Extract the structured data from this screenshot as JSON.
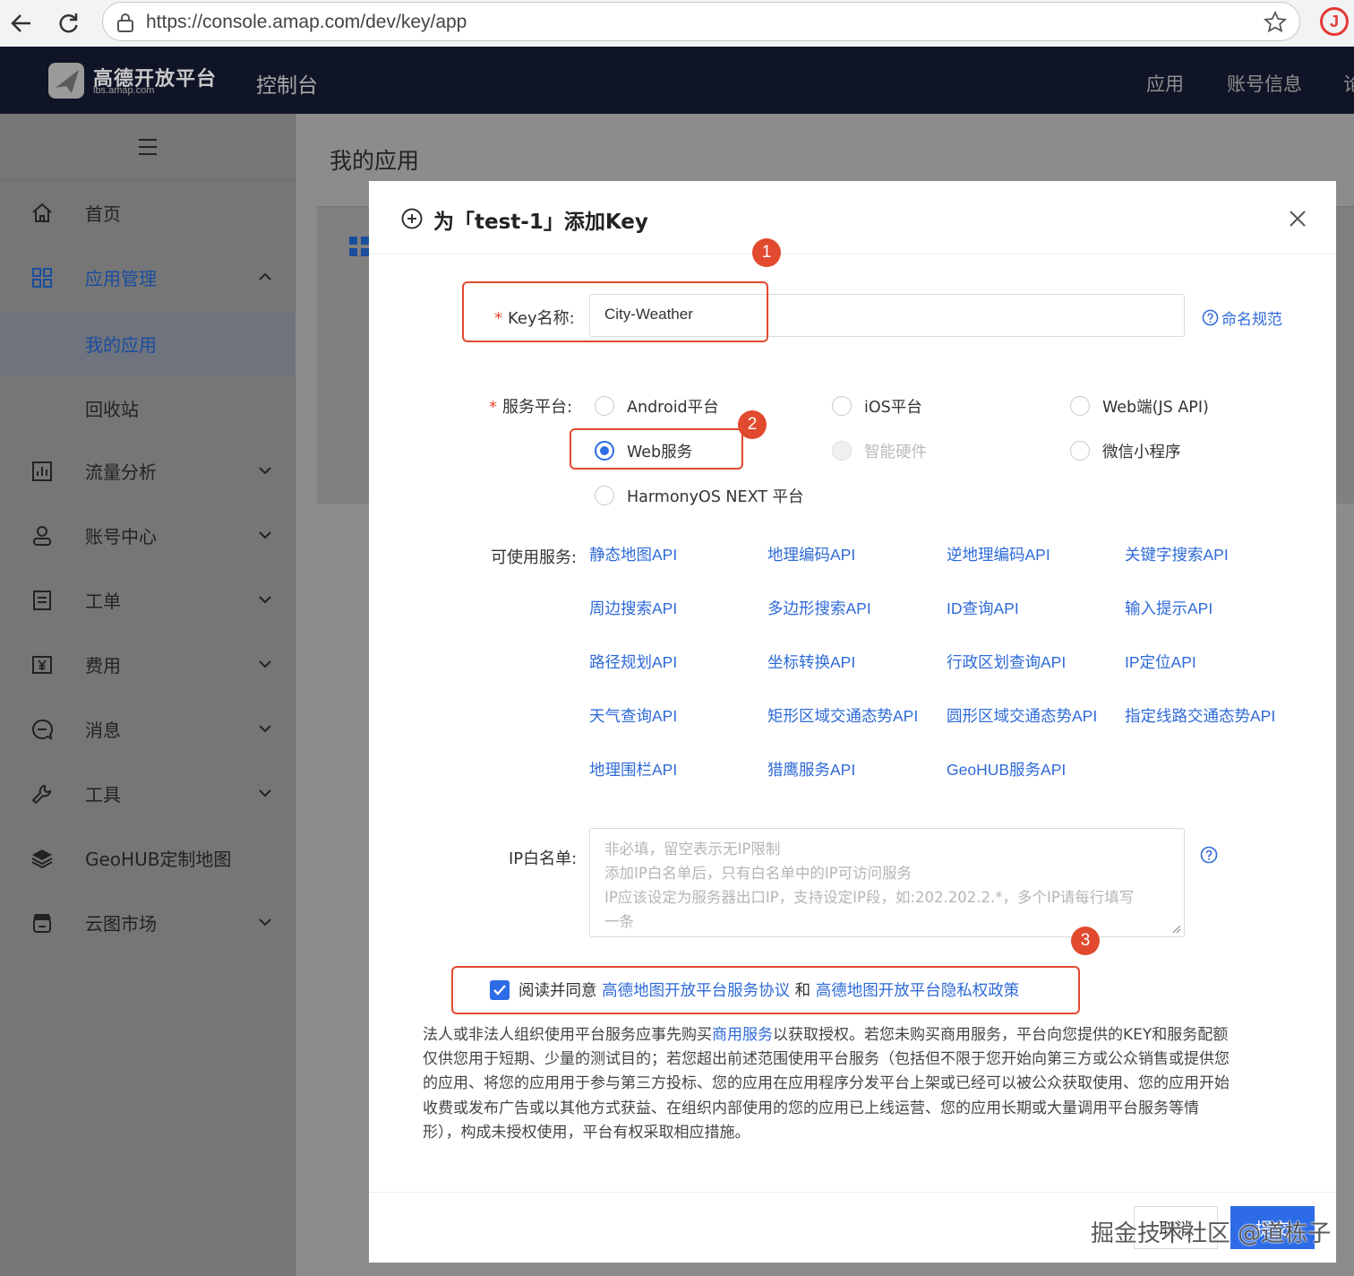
{
  "browser": {
    "url": "https://console.amap.com/dev/key/app"
  },
  "topnav": {
    "logo_title": "高德开放平台",
    "logo_sub": "lbs.amap.com",
    "console": "控制台",
    "items": [
      "应用",
      "账号信息",
      "论"
    ]
  },
  "sidebar": {
    "home": "首页",
    "app_manage": "应用管理",
    "my_apps": "我的应用",
    "recycle": "回收站",
    "traffic": "流量分析",
    "account": "账号中心",
    "ticket": "工单",
    "fee": "费用",
    "message": "消息",
    "tools": "工具",
    "geohub": "GeoHUB定制地图",
    "cloud_market": "云图市场"
  },
  "main": {
    "title": "我的应用"
  },
  "modal": {
    "title": "为「test-1」添加Key",
    "key_name_label": "Key名称:",
    "key_name_value": "City-Weather",
    "naming_rule": "命名规范",
    "platform_label": "服务平台:",
    "platforms": {
      "android": "Android平台",
      "ios": "iOS平台",
      "web_js": "Web端(JS API)",
      "web_service": "Web服务",
      "hardware": "智能硬件",
      "wechat": "微信小程序",
      "harmony": "HarmonyOS NEXT 平台"
    },
    "selected_platform": "Web服务",
    "services_label": "可使用服务:",
    "services": [
      "静态地图API",
      "地理编码API",
      "逆地理编码API",
      "关键字搜索API",
      "周边搜索API",
      "多边形搜索API",
      "ID查询API",
      "输入提示API",
      "路径规划API",
      "坐标转换API",
      "行政区划查询API",
      "IP定位API",
      "天气查询API",
      "矩形区域交通态势API",
      "圆形区域交通态势API",
      "指定线路交通态势API",
      "地理围栏API",
      "猎鹰服务API",
      "GeoHUB服务API"
    ],
    "ip_label": "IP白名单:",
    "ip_placeholder_lines": [
      "非必填，留空表示无IP限制",
      "添加IP白名单后，只有白名单中的IP可访问服务",
      "IP应该设定为服务器出口IP，支持设定IP段，如:202.202.2.*，多个IP请每行填写",
      "一条"
    ],
    "agree_prefix": "阅读并同意",
    "agree_link1": "高德地图开放平台服务协议",
    "agree_and": "和",
    "agree_link2": "高德地图开放平台隐私权政策",
    "agree_checked": true,
    "notice_line1_a": "法人或非法人组织使用平台服务应事先购买",
    "notice_line1_link": "商用服务",
    "notice_line1_b": "以获取授权。若您未购买商用服务，平台向您提供的KEY和服务配额",
    "notice_lines": [
      "仅供您用于短期、少量的测试目的；若您超出前述范围使用平台服务（包括但不限于您开始向第三方或公众销售或提供您",
      "的应用、将您的应用用于参与第三方投标、您的应用在应用程序分发平台上架或已经可以被公众获取使用、您的应用开始",
      "收费或发布广告或以其他方式获益、在组织内部使用的您的应用已上线运营、您的应用长期或大量调用平台服务等情",
      "形），构成未授权使用，平台有权采取相应措施。"
    ],
    "cancel": "取消",
    "submit": "提交"
  },
  "annotations": [
    "1",
    "2",
    "3"
  ],
  "watermark": "掘金技术社区 @道栋子",
  "colors": {
    "accent": "#2e6be6",
    "link": "#2f6bd8",
    "annotation": "#e14a2e",
    "topnav": "#0f1527"
  }
}
